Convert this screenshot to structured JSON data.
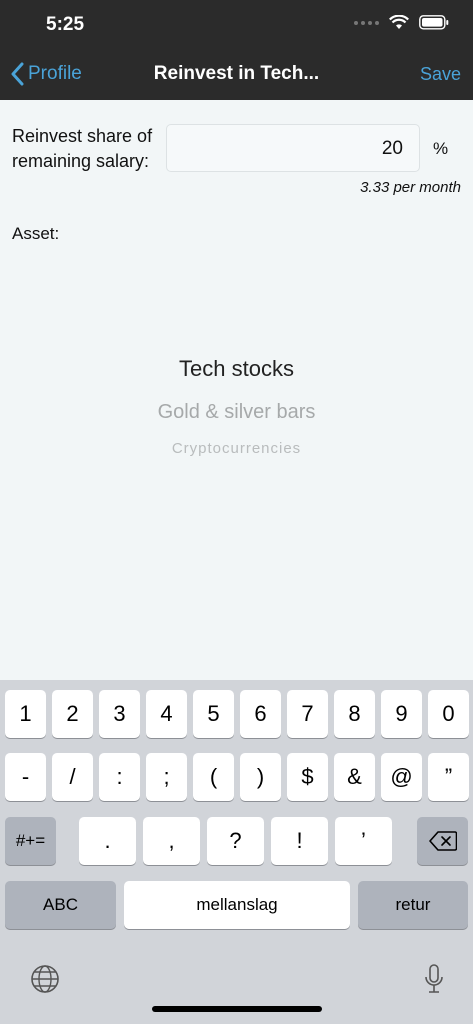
{
  "status_bar": {
    "time": "5:25"
  },
  "nav": {
    "back_label": "Profile",
    "title": "Reinvest in Tech...",
    "save_label": "Save"
  },
  "form": {
    "share_label": "Reinvest share of remaining salary:",
    "share_value": "20",
    "share_unit": "%",
    "per_month": "3.33 per month",
    "asset_label": "Asset:",
    "asset_options": [
      "Tech stocks",
      "Gold & silver bars",
      "Cryptocurrencies"
    ]
  },
  "keyboard": {
    "row1": [
      "1",
      "2",
      "3",
      "4",
      "5",
      "6",
      "7",
      "8",
      "9",
      "0"
    ],
    "row2": [
      "-",
      "/",
      ":",
      ";",
      "(",
      ")",
      "$",
      "&",
      "@",
      "”"
    ],
    "row3": [
      ".",
      ",",
      "?",
      "!",
      "’"
    ],
    "mode_switch": "#+=",
    "abc": "ABC",
    "space": "mellanslag",
    "return": "retur"
  },
  "icons": {
    "back": "chevron-left-icon",
    "delete": "backspace-icon",
    "globe": "globe-icon",
    "mic": "microphone-icon"
  },
  "colors": {
    "accent": "#4aa3d8",
    "bar": "#2b2b2b"
  }
}
